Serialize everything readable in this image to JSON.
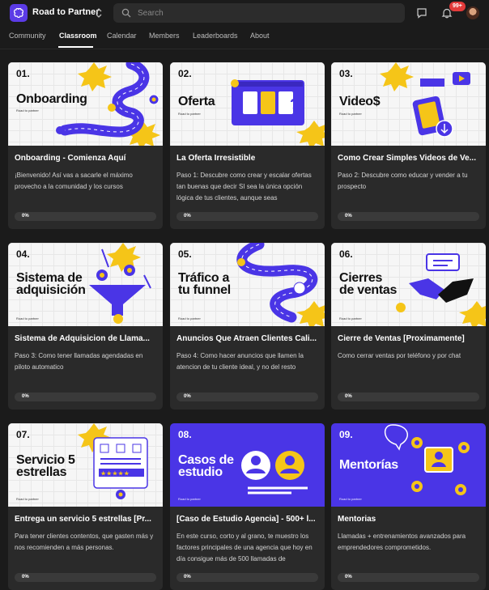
{
  "header": {
    "community_name": "Road to Partner",
    "search_placeholder": "Search",
    "notification_count": "99+"
  },
  "nav": {
    "tabs": [
      {
        "label": "Community"
      },
      {
        "label": "Classroom"
      },
      {
        "label": "Calendar"
      },
      {
        "label": "Members"
      },
      {
        "label": "Leaderboards"
      },
      {
        "label": "About"
      }
    ],
    "active_tab": "Classroom"
  },
  "brand_footer": "Road to partner",
  "courses": [
    {
      "num": "01.",
      "thumb_title": [
        "Onboarding"
      ],
      "title": "Onboarding - Comienza Aquí",
      "desc": "¡Bienvenido! Así vas a sacarle el máximo provecho a la comunidad y los cursos",
      "progress_label": "0%",
      "progress": 0
    },
    {
      "num": "02.",
      "thumb_title": [
        "Oferta"
      ],
      "title": "La Oferta Irresistible",
      "desc": "Paso 1: Descubre como crear y escalar ofertas tan buenas que decir SI sea la única opción lógica de tus clientes, aunque seas",
      "progress_label": "0%",
      "progress": 0
    },
    {
      "num": "03.",
      "thumb_title": [
        "Video$"
      ],
      "title": "Como Crear Simples Videos de Ve...",
      "desc": "Paso 2: Descubre como educar y vender a tu prospecto",
      "progress_label": "0%",
      "progress": 0
    },
    {
      "num": "04.",
      "thumb_title": [
        "Sistema de",
        "adquisición"
      ],
      "title": "Sistema de Adquisicion de Llama...",
      "desc": "Paso 3: Como tener llamadas agendadas en piloto automatico",
      "progress_label": "0%",
      "progress": 0
    },
    {
      "num": "05.",
      "thumb_title": [
        "Tráfico a",
        "tu funnel"
      ],
      "title": "Anuncios Que Atraen Clientes Cali...",
      "desc": "Paso 4: Como hacer anuncios que llamen la atencion de tu cliente ideal, y no del resto",
      "progress_label": "0%",
      "progress": 0
    },
    {
      "num": "06.",
      "thumb_title": [
        "Cierres",
        "de ventas"
      ],
      "title": "Cierre de Ventas [Proximamente]",
      "desc": "Como cerrar ventas por teléfono y por chat",
      "progress_label": "0%",
      "progress": 0
    },
    {
      "num": "07.",
      "thumb_title": [
        "Servicio 5",
        "estrellas"
      ],
      "title": "Entrega un servicio 5 estrellas [Pr...",
      "desc": "Para tener clientes contentos, que gasten más y nos recomienden a más personas.",
      "progress_label": "0%",
      "progress": 0
    },
    {
      "num": "08.",
      "thumb_title": [
        "Casos de",
        "estudio"
      ],
      "title": "[Caso de Estudio Agencia] - 500+ l...",
      "desc": "En este curso, corto y al grano, te muestro los factores principales de una agencia que hoy en día consigue más de 500 llamadas de",
      "progress_label": "0%",
      "progress": 0
    },
    {
      "num": "09.",
      "thumb_title": [
        "Mentorías"
      ],
      "title": "Mentorias",
      "desc": "Llamadas + entrenamientos avanzados para emprendedores comprometidos.",
      "progress_label": "0%",
      "progress": 0
    }
  ],
  "colors": {
    "accent": "#5b3be6",
    "yellow": "#f5c518",
    "background": "#1b1b1b",
    "card": "#2a2a2a"
  },
  "icons": {
    "logo": "brain-icon",
    "search": "search-icon",
    "chat": "chat-bubble-icon",
    "notifications": "bell-icon",
    "switcher": "chevron-updown-icon"
  }
}
